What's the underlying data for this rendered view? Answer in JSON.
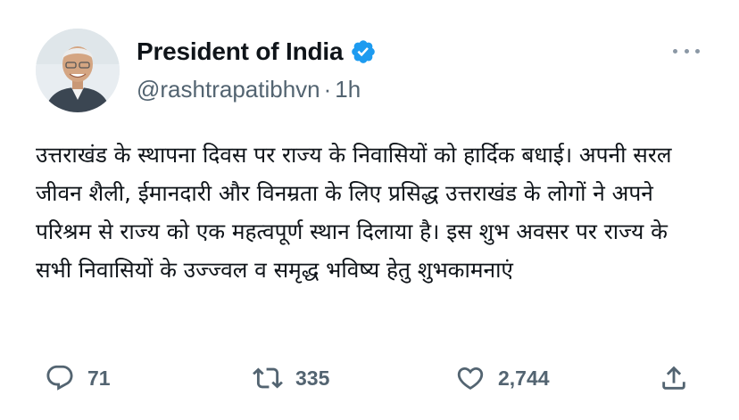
{
  "author": {
    "display_name": "President of India",
    "handle": "@rashtrapatibhvn",
    "separator": "·",
    "time": "1h",
    "verified": true
  },
  "tweet_text": "उत्तराखंड के स्थापना दिवस पर राज्य के निवासियों को हार्दिक बधाई। अपनी सरल जीवन शैली, ईमानदारी और विनम्रता के लिए प्रसिद्ध उत्तराखंड के लोगों ने अपने परिश्रम से राज्य को एक महत्वपूर्ण स्थान दिलाया है। इस शुभ अवसर पर राज्य के सभी निवासियों के उज्ज्वल व समृद्ध भविष्य हेतु शुभकामनाएं",
  "actions": {
    "reply_count": "71",
    "retweet_count": "335",
    "like_count": "2,744"
  },
  "icons": {
    "verified": "verified-badge-icon",
    "more": "more-options-icon",
    "reply": "reply-icon",
    "retweet": "retweet-icon",
    "like": "heart-icon",
    "share": "share-icon"
  },
  "colors": {
    "verified_blue": "#1d9bf0",
    "secondary_text": "#536471",
    "primary_text": "#0f1419"
  }
}
